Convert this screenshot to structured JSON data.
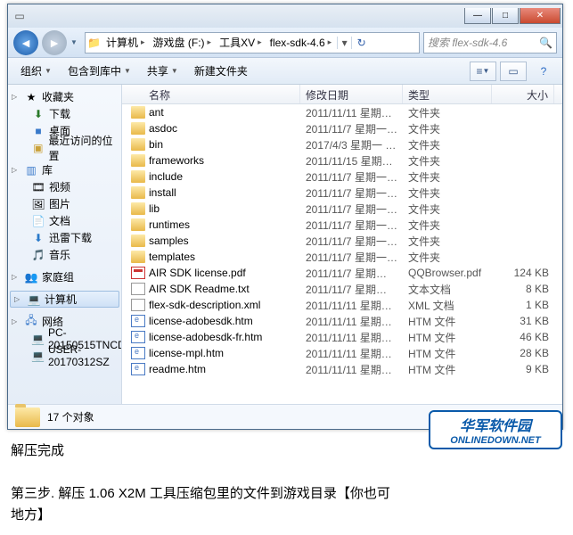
{
  "breadcrumbs": [
    "计算机",
    "游戏盘 (F:)",
    "工具XV",
    "flex-sdk-4.6"
  ],
  "search": {
    "placeholder": "搜索 flex-sdk-4.6"
  },
  "toolbar": {
    "organize": "组织",
    "include": "包含到库中",
    "share": "共享",
    "newfolder": "新建文件夹"
  },
  "sidebar": {
    "favorites": {
      "title": "收藏夹",
      "items": [
        "下载",
        "桌面",
        "最近访问的位置"
      ]
    },
    "libraries": {
      "title": "库",
      "items": [
        "视频",
        "图片",
        "文档",
        "迅雷下载",
        "音乐"
      ]
    },
    "homegroup": "家庭组",
    "computer": "计算机",
    "network": {
      "title": "网络",
      "items": [
        "PC-20150515TNCD",
        "USER-20170312SZ"
      ]
    }
  },
  "columns": {
    "name": "名称",
    "date": "修改日期",
    "type": "类型",
    "size": "大小"
  },
  "files": [
    {
      "icon": "folder",
      "name": "ant",
      "date": "2011/11/11 星期…",
      "type": "文件夹",
      "size": ""
    },
    {
      "icon": "folder",
      "name": "asdoc",
      "date": "2011/11/7 星期一…",
      "type": "文件夹",
      "size": ""
    },
    {
      "icon": "folder",
      "name": "bin",
      "date": "2017/4/3 星期一 …",
      "type": "文件夹",
      "size": ""
    },
    {
      "icon": "folder",
      "name": "frameworks",
      "date": "2011/11/15 星期…",
      "type": "文件夹",
      "size": ""
    },
    {
      "icon": "folder",
      "name": "include",
      "date": "2011/11/7 星期一…",
      "type": "文件夹",
      "size": ""
    },
    {
      "icon": "folder",
      "name": "install",
      "date": "2011/11/7 星期一…",
      "type": "文件夹",
      "size": ""
    },
    {
      "icon": "folder",
      "name": "lib",
      "date": "2011/11/7 星期一…",
      "type": "文件夹",
      "size": ""
    },
    {
      "icon": "folder",
      "name": "runtimes",
      "date": "2011/11/7 星期一…",
      "type": "文件夹",
      "size": ""
    },
    {
      "icon": "folder",
      "name": "samples",
      "date": "2011/11/7 星期一…",
      "type": "文件夹",
      "size": ""
    },
    {
      "icon": "folder",
      "name": "templates",
      "date": "2011/11/7 星期一…",
      "type": "文件夹",
      "size": ""
    },
    {
      "icon": "pdf",
      "name": "AIR SDK license.pdf",
      "date": "2011/11/7 星期…",
      "type": "QQBrowser.pdf",
      "size": "124 KB"
    },
    {
      "icon": "txt",
      "name": "AIR SDK Readme.txt",
      "date": "2011/11/7 星期…",
      "type": "文本文档",
      "size": "8 KB"
    },
    {
      "icon": "xml",
      "name": "flex-sdk-description.xml",
      "date": "2011/11/11 星期…",
      "type": "XML 文档",
      "size": "1 KB"
    },
    {
      "icon": "htm",
      "name": "license-adobesdk.htm",
      "date": "2011/11/11 星期…",
      "type": "HTM 文件",
      "size": "31 KB"
    },
    {
      "icon": "htm",
      "name": "license-adobesdk-fr.htm",
      "date": "2011/11/11 星期…",
      "type": "HTM 文件",
      "size": "46 KB"
    },
    {
      "icon": "htm",
      "name": "license-mpl.htm",
      "date": "2011/11/11 星期…",
      "type": "HTM 文件",
      "size": "28 KB"
    },
    {
      "icon": "htm",
      "name": "readme.htm",
      "date": "2011/11/11 星期…",
      "type": "HTM 文件",
      "size": "9 KB"
    }
  ],
  "status": "17 个对象",
  "below": {
    "line1": "解压完成",
    "line2": "第三步. 解压 1.06 X2M 工具压缩包里的文件到游戏目录【你也可",
    "line3": "地方】"
  },
  "logo": {
    "cn": "华军软件园",
    "en": "ONLINEDOWN.NET"
  }
}
